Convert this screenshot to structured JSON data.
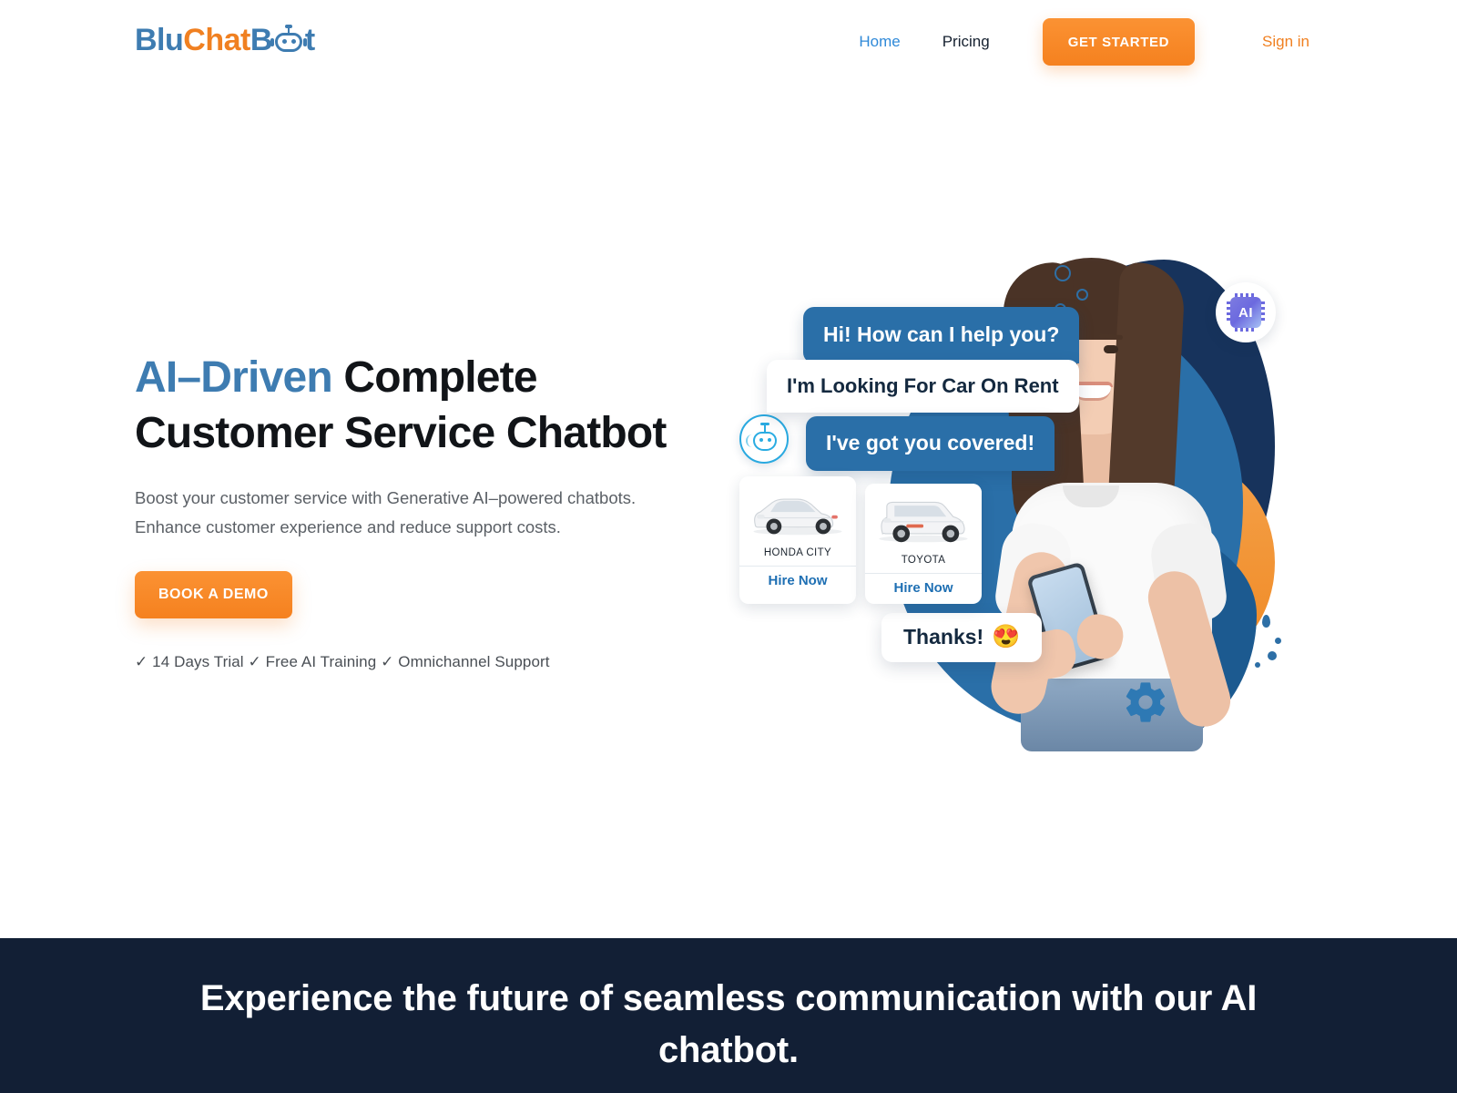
{
  "brand": {
    "name": "BluChatBot",
    "logo_parts": {
      "p1": "Blu",
      "p2": "Chat",
      "p3": "B",
      "p4": "t"
    },
    "colors": {
      "blue": "#3E7CB1",
      "orange": "#F08021",
      "navy": "#121F35",
      "bubble_blue": "#2A6FA8"
    }
  },
  "nav": {
    "home": "Home",
    "pricing": "Pricing",
    "get_started": "GET STARTED",
    "sign_in": "Sign in"
  },
  "hero": {
    "title_accent": "AI–Driven",
    "title_rest": " Complete",
    "title_line2": "Customer Service Chatbot",
    "subtitle_line1": "Boost your customer service with Generative AI–powered chatbots.",
    "subtitle_line2": "Enhance customer experience and reduce support costs.",
    "cta": "BOOK A DEMO",
    "features": "✓ 14 Days Trial ✓ Free AI Training ✓ Omnichannel Support"
  },
  "chat": {
    "bubble1": "Hi! How can I help you?",
    "bubble2": "I'm Looking For Car On Rent",
    "bubble3": "I've got you covered!",
    "bubble4": "Thanks!",
    "bubble4_emoji": "😍",
    "ai_badge": "AI",
    "cars": [
      {
        "name": "HONDA CITY",
        "action": "Hire Now"
      },
      {
        "name": "TOYOTA",
        "action": "Hire Now"
      }
    ]
  },
  "dark_section": {
    "heading": "Experience the future of seamless communication with our AI chatbot."
  }
}
